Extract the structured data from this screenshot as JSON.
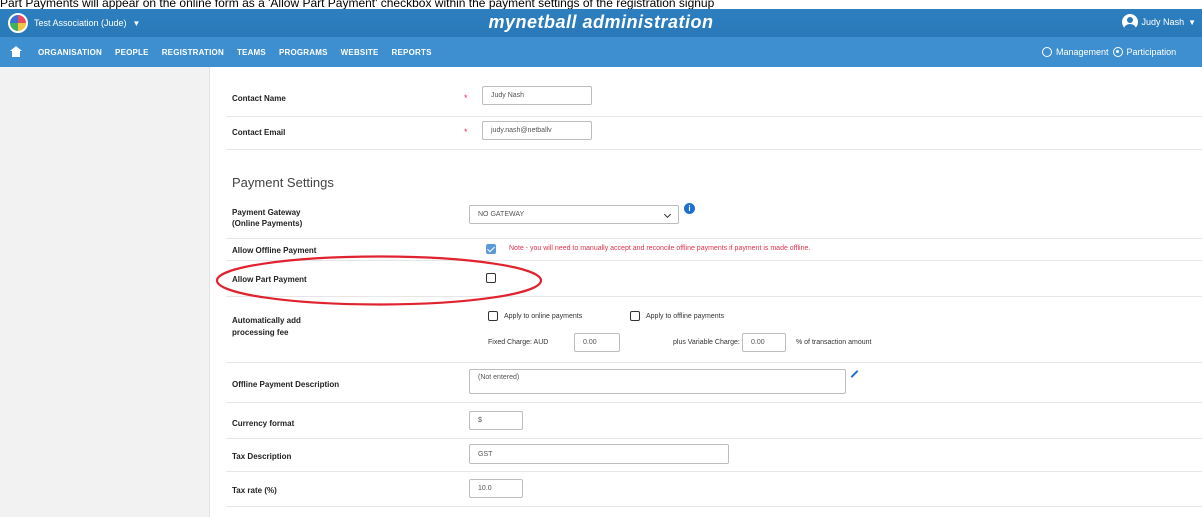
{
  "caption": "Part Payments will appear on the online form as a 'Allow Part Payment' checkbox within the payment settings of the registration signup",
  "header": {
    "org_name": "Test Association (Jude)",
    "app_title": "mynetball administration",
    "user_name": "Judy Nash"
  },
  "nav": {
    "items": [
      "ORGANISATION",
      "PEOPLE",
      "REGISTRATION",
      "TEAMS",
      "PROGRAMS",
      "WEBSITE",
      "REPORTS"
    ],
    "management": "Management",
    "participation": "Participation"
  },
  "form": {
    "contact_name": {
      "label": "Contact Name",
      "value": "Judy Nash",
      "required": "*"
    },
    "contact_email": {
      "label": "Contact Email",
      "value": "judy.nash@netballv",
      "required": "*"
    },
    "payment_settings_title": "Payment Settings",
    "payment_gateway": {
      "label_line1": "Payment Gateway",
      "label_line2": "(Online Payments)",
      "value": "NO GATEWAY"
    },
    "allow_offline_payment": {
      "label": "Allow Offline Payment",
      "checked": true,
      "note": "Note - you will need to manually accept and reconcile offline payments if payment is made offline."
    },
    "allow_part_payment": {
      "label": "Allow Part Payment",
      "checked": false
    },
    "processing_fee": {
      "label_line1": "Automatically add",
      "label_line2": "processing fee",
      "apply_online": "Apply to online payments",
      "apply_offline": "Apply to offline payments",
      "fixed_label": "Fixed Charge: AUD",
      "fixed_value": "0.00",
      "variable_label": "plus Variable Charge:",
      "variable_value": "0.00",
      "percent_label": "% of transaction amount"
    },
    "offline_description": {
      "label": "Offline Payment Description",
      "value": "(Not entered)"
    },
    "currency_format": {
      "label": "Currency format",
      "value": "$"
    },
    "tax_description": {
      "label": "Tax Description",
      "value": "GST"
    },
    "tax_rate": {
      "label": "Tax rate (%)",
      "value": "10.0"
    }
  },
  "colors": {
    "topbar": "#2a79b8",
    "navbar": "#3e8fcf",
    "required": "#e0334f",
    "highlight": "#e0232f"
  }
}
